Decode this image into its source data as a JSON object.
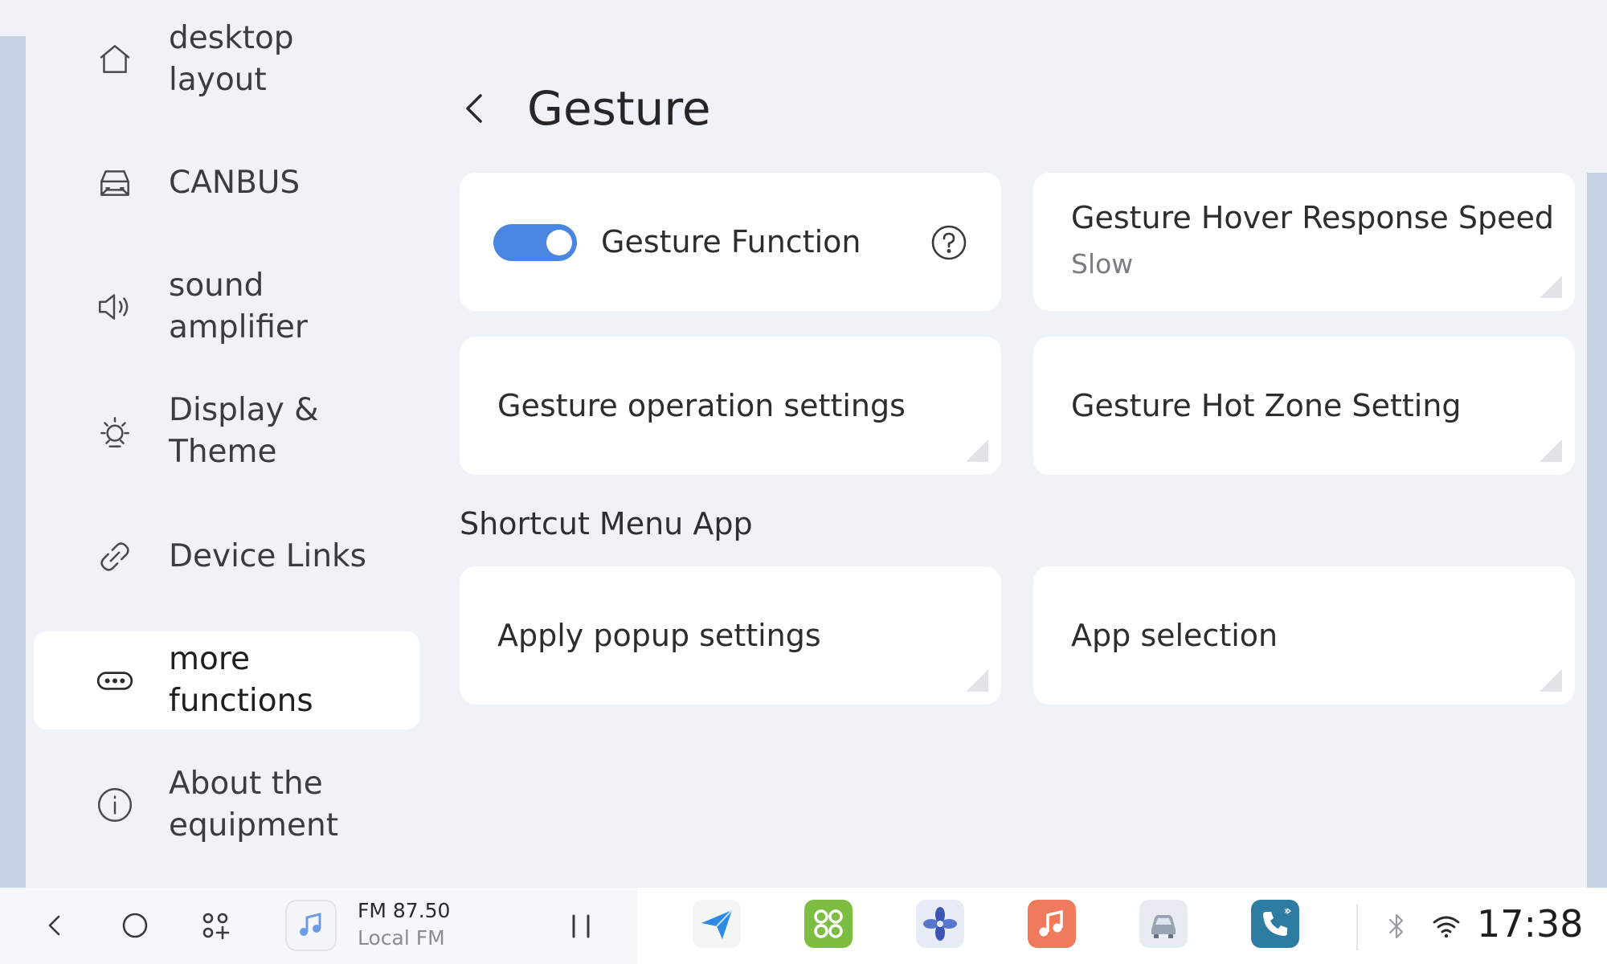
{
  "sidebar": {
    "items": [
      {
        "label_line1": "desktop",
        "label_line2": "layout",
        "icon": "home-icon"
      },
      {
        "label_line1": "CANBUS",
        "label_line2": "",
        "icon": "car-icon"
      },
      {
        "label_line1": "sound",
        "label_line2": "amplifier",
        "icon": "speaker-icon"
      },
      {
        "label_line1": "Display &",
        "label_line2": "Theme",
        "icon": "sun-icon"
      },
      {
        "label_line1": "Device Links",
        "label_line2": "",
        "icon": "link-icon"
      },
      {
        "label_line1": "more",
        "label_line2": "functions",
        "icon": "more-icon",
        "active": true
      },
      {
        "label_line1": "About the",
        "label_line2": "equipment",
        "icon": "info-icon"
      }
    ]
  },
  "header": {
    "title": "Gesture"
  },
  "cards": {
    "gesture_function": {
      "label": "Gesture Function",
      "toggle_on": true
    },
    "hover_speed": {
      "label": "Gesture Hover Response Speed",
      "value": "Slow"
    },
    "operation_settings": {
      "label": "Gesture operation settings"
    },
    "hot_zone": {
      "label": "Gesture Hot Zone Setting"
    },
    "popup_settings": {
      "label": "Apply popup settings"
    },
    "app_selection": {
      "label": "App selection"
    }
  },
  "section": {
    "shortcut_title": "Shortcut Menu App"
  },
  "taskbar": {
    "media": {
      "frequency": "FM 87.50",
      "source": "Local FM"
    },
    "dock_apps": [
      "navigation-app-icon",
      "apps-grid-app-icon",
      "fan-app-icon",
      "music-app-icon",
      "car-app-icon",
      "phone-app-icon"
    ],
    "time": "17:38"
  },
  "colors": {
    "accent": "#4a86e0",
    "background": "#eff3f7",
    "card": "#ffffff"
  }
}
